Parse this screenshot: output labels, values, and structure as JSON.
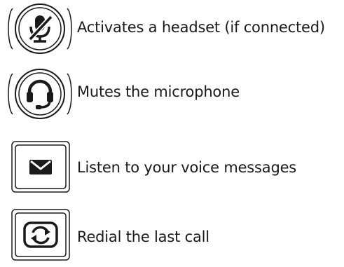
{
  "items": [
    {
      "icon": "mute-microphone-icon",
      "label": "Activates a headset (if connected)"
    },
    {
      "icon": "headset-icon",
      "label": "Mutes the microphone"
    },
    {
      "icon": "envelope-icon",
      "label": "Listen to your voice messages"
    },
    {
      "icon": "redial-icon",
      "label": "Redial the last call"
    }
  ],
  "colors": {
    "ink": "#1a1a1a",
    "background": "#ffffff"
  }
}
